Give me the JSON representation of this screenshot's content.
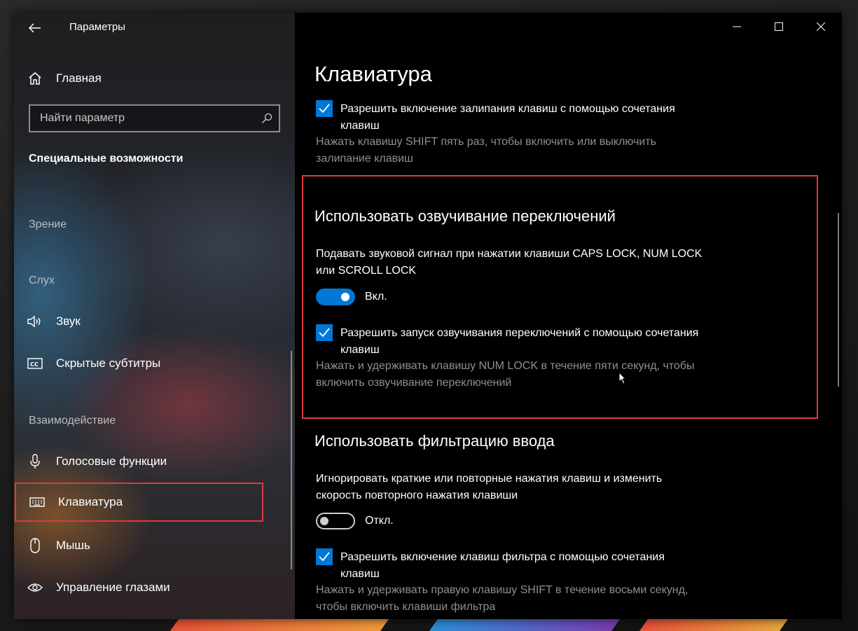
{
  "window": {
    "title": "Параметры",
    "controls": {
      "minimize": "minimize-icon",
      "maximize": "maximize-icon",
      "close": "close-icon"
    }
  },
  "sidebar": {
    "home_label": "Главная",
    "search": {
      "placeholder": "Найти параметр"
    },
    "section_title": "Специальные возможности",
    "groups": [
      {
        "header": "Зрение",
        "items": []
      },
      {
        "header": "Слух",
        "items": [
          {
            "label": "Звук",
            "icon": "speaker-icon"
          },
          {
            "label": "Скрытые субтитры",
            "icon": "closed-captions-icon"
          }
        ]
      },
      {
        "header": "Взаимодействие",
        "items": [
          {
            "label": "Голосовые функции",
            "icon": "microphone-icon"
          },
          {
            "label": "Клавиатура",
            "icon": "keyboard-icon",
            "selected": true
          },
          {
            "label": "Мышь",
            "icon": "mouse-icon"
          },
          {
            "label": "Управление глазами",
            "icon": "eye-icon"
          }
        ]
      }
    ]
  },
  "content": {
    "page_title": "Клавиатура",
    "sticky_keys": {
      "checkbox_label": "Разрешить включение залипания клавиш с помощью сочетания клавиш",
      "checked": true,
      "help": "Нажать клавишу SHIFT пять раз, чтобы включить или выключить залипание клавиш"
    },
    "toggle_keys": {
      "heading": "Использовать озвучивание переключений",
      "description": "Подавать звуковой сигнал при нажатии клавиши CAPS LOCK, NUM LOCK или SCROLL LOCK",
      "toggle_state": "Вкл.",
      "toggle_on": true,
      "checkbox_label": "Разрешить запуск озвучивания переключений с помощью сочетания клавиш",
      "checked": true,
      "help": "Нажать и удерживать клавишу NUM LOCK в течение пяти секунд, чтобы включить озвучивание переключений"
    },
    "filter_keys": {
      "heading": "Использовать фильтрацию ввода",
      "description": "Игнорировать краткие или повторные нажатия клавиш и изменить скорость повторного нажатия клавиши",
      "toggle_state": "Откл.",
      "toggle_on": false,
      "checkbox_label": "Разрешить включение клавиш фильтра с помощью сочетания клавиш",
      "checked": true,
      "help": "Нажать и удерживать правую клавишу SHIFT в течение восьми секунд, чтобы включить клавиши фильтра"
    }
  },
  "colors": {
    "accent": "#0078d7",
    "highlight": "#e0383e",
    "help_text": "#8f8f8f"
  }
}
